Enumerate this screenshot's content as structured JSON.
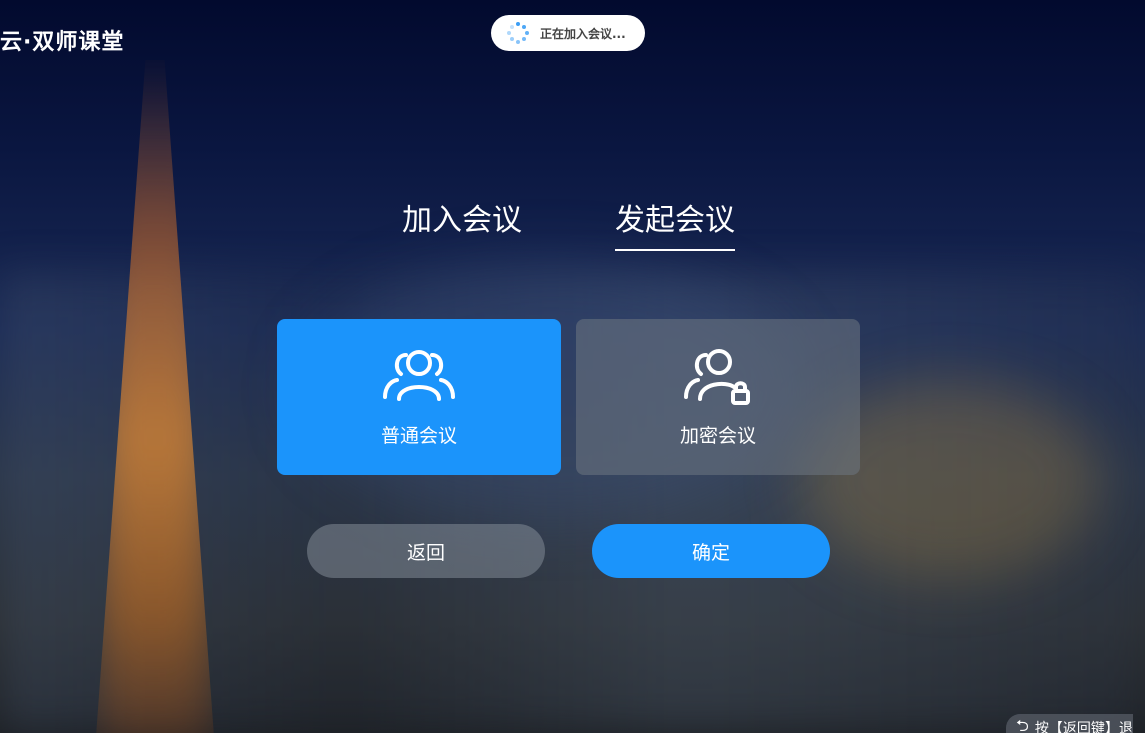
{
  "header": {
    "logo_text": "云·双师课堂"
  },
  "toast": {
    "icon": "loading-spinner-icon",
    "text": "正在加入会议..."
  },
  "tabs": [
    {
      "label": "加入会议",
      "active": false
    },
    {
      "label": "发起会议",
      "active": true
    }
  ],
  "meeting_types": [
    {
      "label": "普通会议",
      "icon": "group-users-icon",
      "selected": true
    },
    {
      "label": "加密会议",
      "icon": "group-lock-icon",
      "selected": false
    }
  ],
  "actions": {
    "back_label": "返回",
    "confirm_label": "确定"
  },
  "footer_hint": {
    "icon": "return-arrow-icon",
    "text": "按【返回键】退"
  },
  "colors": {
    "accent": "#1b94fb",
    "card_inactive": "#6e7682",
    "text": "#ffffff"
  }
}
